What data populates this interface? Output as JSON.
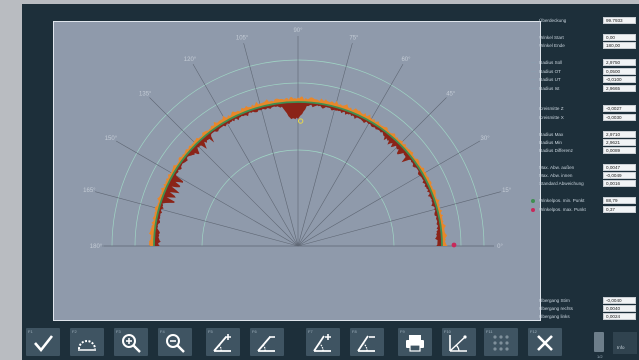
{
  "right_panel": {
    "rows": [
      {
        "label": "Überdeckung",
        "value": "99.7933"
      },
      {
        "label": "Winkel Start",
        "value": "0,00"
      },
      {
        "label": "Winkel Ende",
        "value": "180,00"
      },
      {
        "label": "Radius Soll",
        "value": "2,9750"
      },
      {
        "label": "Radius OT",
        "value": "0,0500"
      },
      {
        "label": "Radius UT",
        "value": "-0,0100"
      },
      {
        "label": "Radius Ist",
        "value": "2,9665"
      },
      {
        "label": "Kreismitte Z",
        "value": "-0,0027"
      },
      {
        "label": "Kreismitte X",
        "value": "-0,0030"
      },
      {
        "label": "Radius Max",
        "value": "2,9710"
      },
      {
        "label": "Radius Min",
        "value": "2,9621"
      },
      {
        "label": "Radius Differenz",
        "value": "0,0089"
      },
      {
        "label": "Max. Abw. außen",
        "value": "0,0047"
      },
      {
        "label": "Max. Abw. innen",
        "value": "-0,0049"
      },
      {
        "label": "Standard Abweichung",
        "value": "0,0016"
      },
      {
        "label": "Winkelpos. min. Punkt",
        "value": "88,79"
      },
      {
        "label": "Winkelpos. max. Punkt",
        "value": "0,37"
      },
      {
        "label": "Übergang Stirn",
        "value": "-0,0040"
      },
      {
        "label": "Übergang rechts",
        "value": "0,0040"
      },
      {
        "label": "Übergang links",
        "value": "0,0024"
      }
    ]
  },
  "toolbar": {
    "buttons": [
      {
        "key": "F1",
        "icon": "confirm-check-icon"
      },
      {
        "key": "F2",
        "icon": "fit-arc-icon"
      },
      {
        "key": "F3",
        "icon": "zoom-in-icon"
      },
      {
        "key": "F4",
        "icon": "zoom-out-icon"
      },
      {
        "key": "F5",
        "icon": "angle-add-icon"
      },
      {
        "key": "F6",
        "icon": "angle-remove-icon"
      },
      {
        "key": "F7",
        "icon": "angle-add-alt-icon"
      },
      {
        "key": "F8",
        "icon": "angle-remove-alt-icon"
      },
      {
        "key": "F9",
        "icon": "print-icon"
      },
      {
        "key": "F10",
        "icon": "angle-chart-icon"
      },
      {
        "key": "F11",
        "icon": "grid-dots-icon"
      },
      {
        "key": "F12",
        "icon": "cancel-x-icon"
      }
    ],
    "side_caption": "1/2",
    "close_label": "Info"
  },
  "polar": {
    "angle_labels": [
      "0°",
      "15°",
      "30°",
      "45°",
      "60°",
      "75°",
      "90°",
      "105°",
      "120°",
      "135°",
      "150°",
      "165°",
      "180°"
    ],
    "colors": {
      "nominal": "#3f8f52",
      "deviation_outer": "#e8872a",
      "deviation_inner": "#8b2418",
      "min_marker": "#e8d84a",
      "max_marker": "#c8285a"
    },
    "marker_angles": {
      "min_point": 88.79,
      "max_point": 0.37
    }
  }
}
